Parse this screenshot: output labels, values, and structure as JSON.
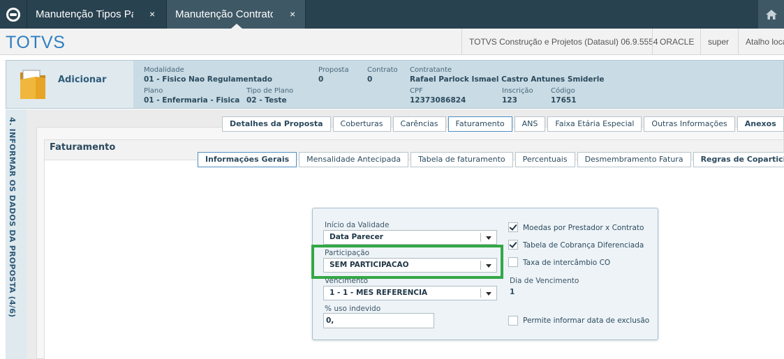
{
  "window_tabs": [
    {
      "label": "Manutenção Tipos Pa",
      "close": "×"
    },
    {
      "label": "Manutenção Contrato",
      "close": "×"
    }
  ],
  "header": {
    "brand": "TOTVS",
    "company": "TOTVS Construção e Projetos (Datasul) 06.9.5554",
    "database": "ORACLE",
    "user": "super",
    "shortcut": "Atalho local"
  },
  "summary": {
    "title": "Adicionar",
    "modalidade_label": "Modalidade",
    "modalidade_value": "01 - Fisico Nao Regulamentado",
    "proposta_label": "Proposta",
    "proposta_value": "0",
    "contrato_label": "Contrato",
    "contrato_value": "0",
    "contratante_label": "Contratante",
    "contratante_value": "Rafael Parlock Ismael Castro Antunes Smiderle",
    "plano_label": "Plano",
    "plano_value": "01 - Enfermaria - Fisica",
    "tipo_plano_label": "Tipo de Plano",
    "tipo_plano_value": "02 - Teste",
    "cpf_label": "CPF",
    "cpf_value": "12373086824",
    "inscricao_label": "Inscrição",
    "inscricao_value": "123",
    "codigo_label": "Código",
    "codigo_value": "17651"
  },
  "step": {
    "label": "4. INFORMAR OS DADOS DA PROPOSTA (4/6)"
  },
  "main_tabs": [
    {
      "label": "Detalhes da Proposta",
      "bold": true
    },
    {
      "label": "Coberturas"
    },
    {
      "label": "Carências"
    },
    {
      "label": "Faturamento",
      "active": true
    },
    {
      "label": "ANS"
    },
    {
      "label": "Faixa Etária Especial"
    },
    {
      "label": "Outras Informações"
    },
    {
      "label": "Anexos",
      "bold": true
    }
  ],
  "faturamento": {
    "title": "Faturamento",
    "tabs": [
      {
        "label": "Informações Gerais",
        "bold": true,
        "active": true
      },
      {
        "label": "Mensalidade Antecipada"
      },
      {
        "label": "Tabela de faturamento"
      },
      {
        "label": "Percentuais"
      },
      {
        "label": "Desmembramento Fatura"
      },
      {
        "label": "Regras de Coparticipação",
        "bold": true
      }
    ]
  },
  "form": {
    "inicio_validade_label": "Início da Validade",
    "inicio_validade_value": "Data Parecer",
    "participacao_label": "Participação",
    "participacao_value": "SEM PARTICIPACAO",
    "vencimento_label": "Vencimento",
    "vencimento_value": "1 - 1 - MES REFERENCIA",
    "uso_indevido_label": "% uso indevido",
    "uso_indevido_value": "0,",
    "moedas_label": "Moedas por Prestador x Contrato",
    "moedas_checked": true,
    "tabela_cobranca_label": "Tabela de Cobrança Diferenciada",
    "tabela_cobranca_checked": true,
    "taxa_intercambio_label": "Taxa de intercâmbio CO",
    "taxa_intercambio_checked": false,
    "dia_vencimento_label": "Dia de Vencimento",
    "dia_vencimento_value": "1",
    "permite_exclusao_label": "Permite informar data de exclusão",
    "permite_exclusao_checked": false
  },
  "colors": {
    "highlight": "#33a845",
    "brand": "#2f7fc1",
    "tabbar": "#294250"
  }
}
